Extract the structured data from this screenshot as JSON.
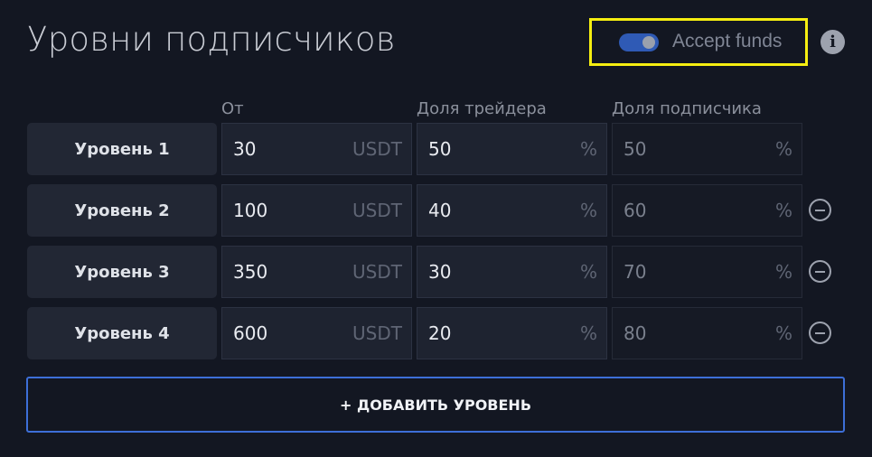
{
  "header": {
    "title": "Уровни подписчиков",
    "accept_funds_label": "Accept funds",
    "accept_funds_enabled": true,
    "info_icon": "i"
  },
  "columns": {
    "from": "От",
    "trader_share": "Доля трейдера",
    "subscriber_share": "Доля подписчика"
  },
  "units": {
    "amount": "USDT",
    "percent": "%"
  },
  "levels": [
    {
      "label": "Уровень 1",
      "from": "30",
      "trader": "50",
      "subscriber": "50",
      "removable": false
    },
    {
      "label": "Уровень 2",
      "from": "100",
      "trader": "40",
      "subscriber": "60",
      "removable": true
    },
    {
      "label": "Уровень 3",
      "from": "350",
      "trader": "30",
      "subscriber": "70",
      "removable": true
    },
    {
      "label": "Уровень 4",
      "from": "600",
      "trader": "20",
      "subscriber": "80",
      "removable": true
    }
  ],
  "add_button_label": "+ ДОБАВИТЬ УРОВЕНЬ",
  "colors": {
    "background": "#131722",
    "accent": "#3d6fd8",
    "highlight_box": "#f5ee11"
  }
}
